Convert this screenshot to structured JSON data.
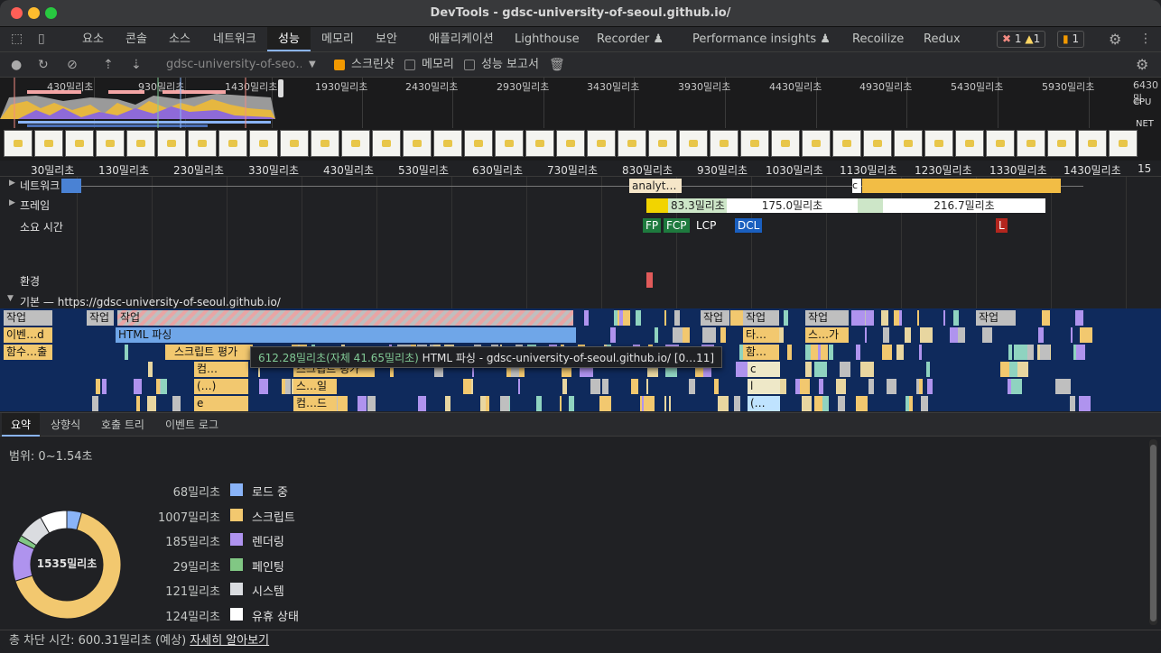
{
  "window": {
    "title": "DevTools - gdsc-university-of-seoul.github.io/"
  },
  "tabs": [
    {
      "label": "요소"
    },
    {
      "label": "콘솔"
    },
    {
      "label": "소스"
    },
    {
      "label": "네트워크"
    },
    {
      "label": "성능"
    },
    {
      "label": "메모리"
    },
    {
      "label": "보안"
    },
    {
      "label": "애플리케이션"
    },
    {
      "label": "Lighthouse"
    },
    {
      "label": "Recorder ♟"
    },
    {
      "label": "Performance insights ♟"
    },
    {
      "label": "Recoilize"
    },
    {
      "label": "Redux"
    }
  ],
  "badges": {
    "errors": "1",
    "warnings": "1",
    "issues": "1"
  },
  "toolbar": {
    "url": "gdsc-university-of-seo…",
    "screenshot_label": "스크린샷",
    "memory_label": "메모리",
    "report_label": "성능 보고서"
  },
  "overview": {
    "ticks": [
      "430밀리초",
      "930밀리초",
      "1430밀리초",
      "1930밀리초",
      "2430밀리초",
      "2930밀리초",
      "3430밀리초",
      "3930밀리초",
      "4430밀리초",
      "4930밀리초",
      "5430밀리초",
      "5930밀리초",
      "6430밀"
    ],
    "cpu_label": "CPU",
    "net_label": "NET"
  },
  "ruler": {
    "ticks": [
      "30밀리초",
      "130밀리초",
      "230밀리초",
      "330밀리초",
      "430밀리초",
      "530밀리초",
      "630밀리초",
      "730밀리초",
      "830밀리초",
      "930밀리초",
      "1030밀리초",
      "1130밀리초",
      "1230밀리초",
      "1330밀리초",
      "1430밀리초",
      "15"
    ]
  },
  "tracks": {
    "network": "네트워크",
    "frames": "프레임",
    "timings": "소요 시간",
    "environment": "환경",
    "main": "기본 — https://gdsc-university-of-seoul.github.io/",
    "network_req": "analyt…",
    "network_c": "c",
    "frame_1": "83.3밀리초",
    "frame_2": "175.0밀리초",
    "frame_3": "216.7밀리초",
    "markers": {
      "fp": "FP",
      "fcp": "FCP",
      "lcp": "LCP",
      "dcl": "DCL",
      "l": "L"
    }
  },
  "flame": {
    "task": "작업",
    "event": "이벤…d",
    "html_parse": "HTML 파싱",
    "func_call": "함수…출",
    "script_eval": "스크립트 평가",
    "compile1": "컴…",
    "script_eval2": "스크립트 평가",
    "anon": "(…)",
    "script_short": "스…일",
    "e": "e",
    "compile2": "컴…드",
    "timer": "타…",
    "func2": "함…",
    "script_end": "스…가",
    "c": "c",
    "l": "l",
    "paren": "(…"
  },
  "tooltip": {
    "time": "612.28밀리초(자체 41.65밀리초)",
    "text": "HTML 파싱 - gdsc-university-of-seoul.github.io/ [0…11]"
  },
  "bottom_tabs": [
    {
      "label": "요약"
    },
    {
      "label": "상향식"
    },
    {
      "label": "호출 트리"
    },
    {
      "label": "이벤트 로그"
    }
  ],
  "summary": {
    "range": "범위: 0~1.54초",
    "total": "1535밀리초",
    "rows": [
      {
        "value": "68밀리초",
        "label": "로드 중",
        "color": "#8ab4f8",
        "ms": 68
      },
      {
        "value": "1007밀리초",
        "label": "스크립트",
        "color": "#f2c86f",
        "ms": 1007
      },
      {
        "value": "185밀리초",
        "label": "렌더링",
        "color": "#af93ee",
        "ms": 185
      },
      {
        "value": "29밀리초",
        "label": "페인팅",
        "color": "#81c784",
        "ms": 29
      },
      {
        "value": "121밀리초",
        "label": "시스템",
        "color": "#dadce0",
        "ms": 121
      },
      {
        "value": "124밀리초",
        "label": "유휴 상태",
        "color": "#ffffff",
        "ms": 124
      }
    ]
  },
  "footer": {
    "blocking": "총 차단 시간: 600.31밀리초 (예상)",
    "link": "자세히 알아보기"
  }
}
